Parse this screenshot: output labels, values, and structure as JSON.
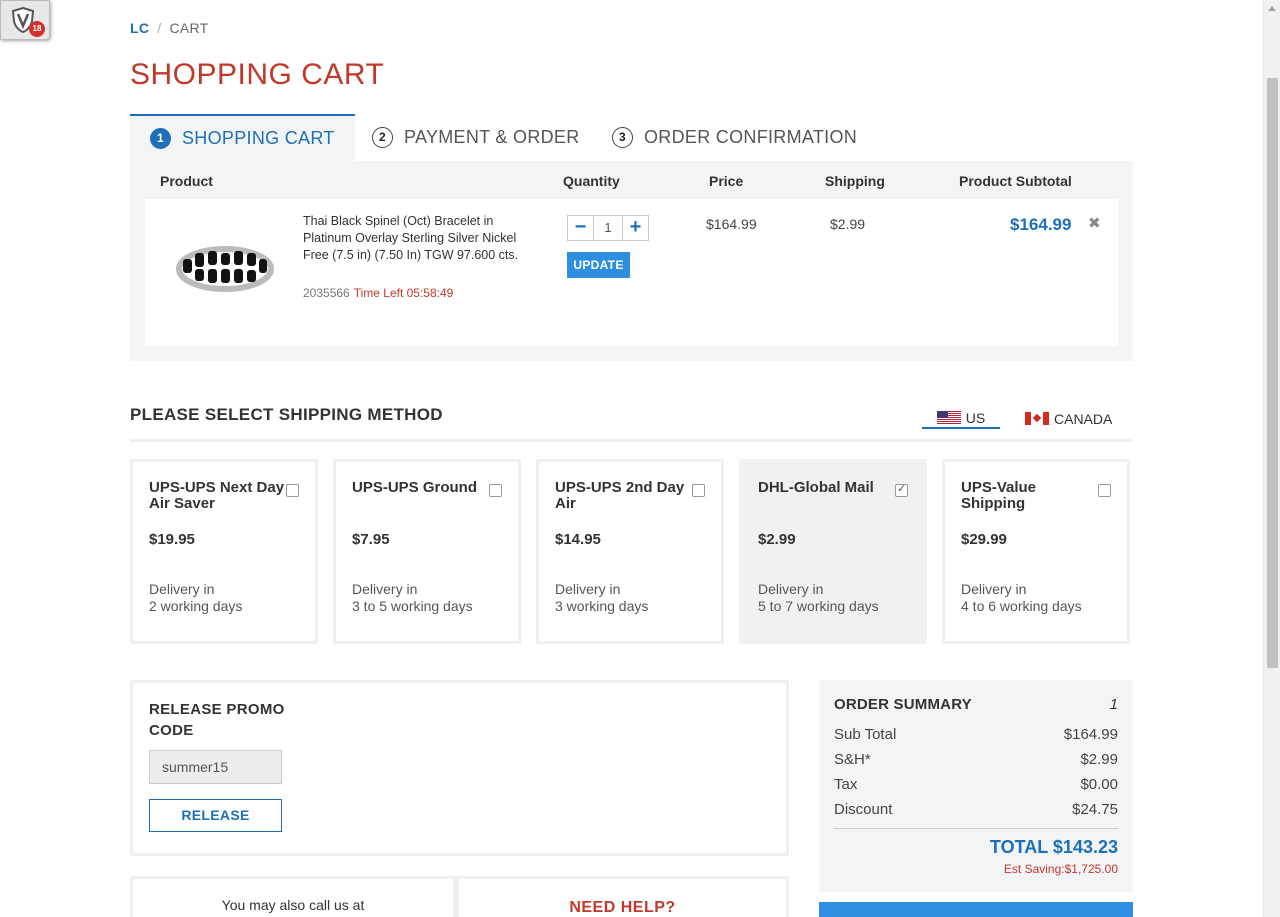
{
  "extension": {
    "badge_count": "18"
  },
  "breadcrumb": {
    "home": "LC",
    "separator": "/",
    "current": "CART"
  },
  "page_title": "SHOPPING CART",
  "steps": [
    {
      "num": "1",
      "label": "SHOPPING CART"
    },
    {
      "num": "2",
      "label": "PAYMENT & ORDER"
    },
    {
      "num": "3",
      "label": "ORDER CONFIRMATION"
    }
  ],
  "cart": {
    "headers": {
      "product": "Product",
      "quantity": "Quantity",
      "price": "Price",
      "shipping": "Shipping",
      "subtotal": "Product Subtotal"
    },
    "item": {
      "name": "Thai Black Spinel (Oct) Bracelet in Platinum Overlay Sterling Silver Nickel Free (7.5 in) (7.50 In) TGW 97.600 cts.",
      "sku": "2035566",
      "timer": "Time Left 05:58:49",
      "qty": "1",
      "minus": "−",
      "plus": "+",
      "update_label": "UPDATE",
      "price": "$164.99",
      "shipping": "$2.99",
      "subtotal": "$164.99",
      "remove": "✖"
    }
  },
  "shipping": {
    "title": "PLEASE SELECT SHIPPING METHOD",
    "countries": [
      "US",
      "CANADA"
    ],
    "methods": [
      {
        "name": "UPS-UPS Next Day Air Saver",
        "cost": "$19.95",
        "delivery_line1": "Delivery in",
        "delivery_line2": "2 working days",
        "checked": false
      },
      {
        "name": "UPS-UPS Ground",
        "cost": "$7.95",
        "delivery_line1": "Delivery in",
        "delivery_line2": "3 to 5 working days",
        "checked": false
      },
      {
        "name": "UPS-UPS 2nd Day Air",
        "cost": "$14.95",
        "delivery_line1": "Delivery in",
        "delivery_line2": "3 working days",
        "checked": false
      },
      {
        "name": "DHL-Global Mail",
        "cost": "$2.99",
        "delivery_line1": "Delivery in",
        "delivery_line2": "5 to 7 working days",
        "checked": true
      },
      {
        "name": "UPS-Value Shipping",
        "cost": "$29.99",
        "delivery_line1": "Delivery in",
        "delivery_line2": "4 to 6 working days",
        "checked": false
      }
    ]
  },
  "promo": {
    "label": "RELEASE PROMO CODE",
    "value": "summer15",
    "button": "RELEASE"
  },
  "help": {
    "call_text": "You may also call us at",
    "need_help": "NEED HELP?"
  },
  "summary": {
    "title": "ORDER SUMMARY",
    "count": "1",
    "lines": [
      {
        "label": "Sub Total",
        "value": "$164.99"
      },
      {
        "label": "S&H*",
        "value": "$2.99"
      },
      {
        "label": "Tax",
        "value": "$0.00"
      },
      {
        "label": "Discount",
        "value": "$24.75"
      }
    ],
    "total": "TOTAL $143.23",
    "saving": "Est Saving:$1,725.00"
  },
  "colors": {
    "accent": "#1d6fb8",
    "title_red": "#c0392b",
    "button_blue": "#2e8fe0",
    "panel_bg": "#f3f4f6"
  }
}
